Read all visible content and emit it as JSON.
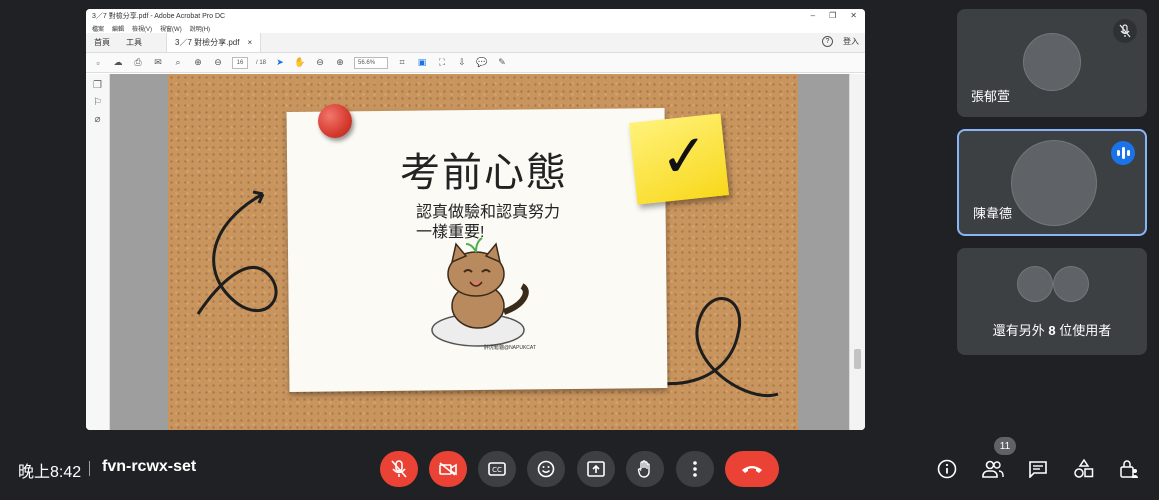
{
  "acrobat": {
    "window_title": "3／7 對檢分享.pdf - Adobe Acrobat Pro DC",
    "menu": [
      "檔案",
      "編輯",
      "檢視(V)",
      "視窗(W)",
      "說明(H)"
    ],
    "tabs": {
      "home": "首頁",
      "tools": "工具",
      "doc": "3／7 對檢分享.pdf"
    },
    "doc_close": "×",
    "help": "?",
    "signin": "登入",
    "page_current": "16",
    "page_total": "/ 18",
    "zoom": "56.6%",
    "win_min": "–",
    "win_max": "❐",
    "win_close": "✕"
  },
  "slide": {
    "title": "考前心態",
    "line1": "認真做驗和認真努力",
    "line2": "一樣重要!",
    "check": "✓",
    "credit": "胖虎鬆貓@NAPUKCAT"
  },
  "participants": [
    {
      "name": "張郁萱",
      "muted": true
    },
    {
      "name": "陳韋德",
      "speaking": true
    }
  ],
  "others": {
    "prefix": "還有另外",
    "count": "8",
    "suffix": "位使用者"
  },
  "meeting": {
    "time": "晚上8:42",
    "code": "fvn-rcwx-set",
    "people_count": "11"
  },
  "colors": {
    "accent_blue": "#1a73e8",
    "end_red": "#ea4335",
    "bg": "#202124",
    "tile": "#3c4043"
  }
}
